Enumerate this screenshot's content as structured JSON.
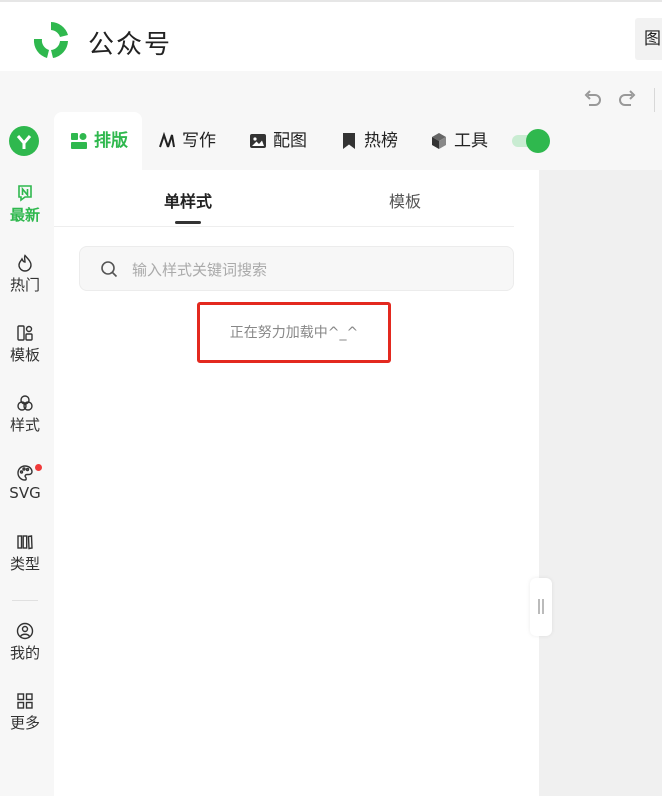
{
  "header": {
    "title": "公众号",
    "right_button": "图"
  },
  "toolbar": {
    "undo": "undo-icon",
    "redo": "redo-icon"
  },
  "leftnav": {
    "items": [
      {
        "label": "最新",
        "icon": "new-badge-icon"
      },
      {
        "label": "热门",
        "icon": "flame-icon"
      },
      {
        "label": "模板",
        "icon": "template-icon"
      },
      {
        "label": "样式",
        "icon": "circles-icon"
      },
      {
        "label": "SVG",
        "icon": "palette-icon"
      },
      {
        "label": "类型",
        "icon": "columns-icon"
      },
      {
        "label": "我的",
        "icon": "user-icon"
      },
      {
        "label": "更多",
        "icon": "grid-icon"
      }
    ]
  },
  "tabs": [
    {
      "label": "排版",
      "icon": "layout-icon"
    },
    {
      "label": "写作",
      "icon": "ai-write-icon"
    },
    {
      "label": "配图",
      "icon": "image-icon"
    },
    {
      "label": "热榜",
      "icon": "bookmark-icon"
    },
    {
      "label": "工具",
      "icon": "cube-icon"
    }
  ],
  "subtabs": [
    {
      "label": "单样式"
    },
    {
      "label": "模板"
    }
  ],
  "search": {
    "placeholder": "输入样式关键词搜索",
    "value": ""
  },
  "loading": {
    "text": "正在努力加载中^_^"
  },
  "colors": {
    "accent": "#2fb84e",
    "highlight_border": "#e3291f"
  }
}
